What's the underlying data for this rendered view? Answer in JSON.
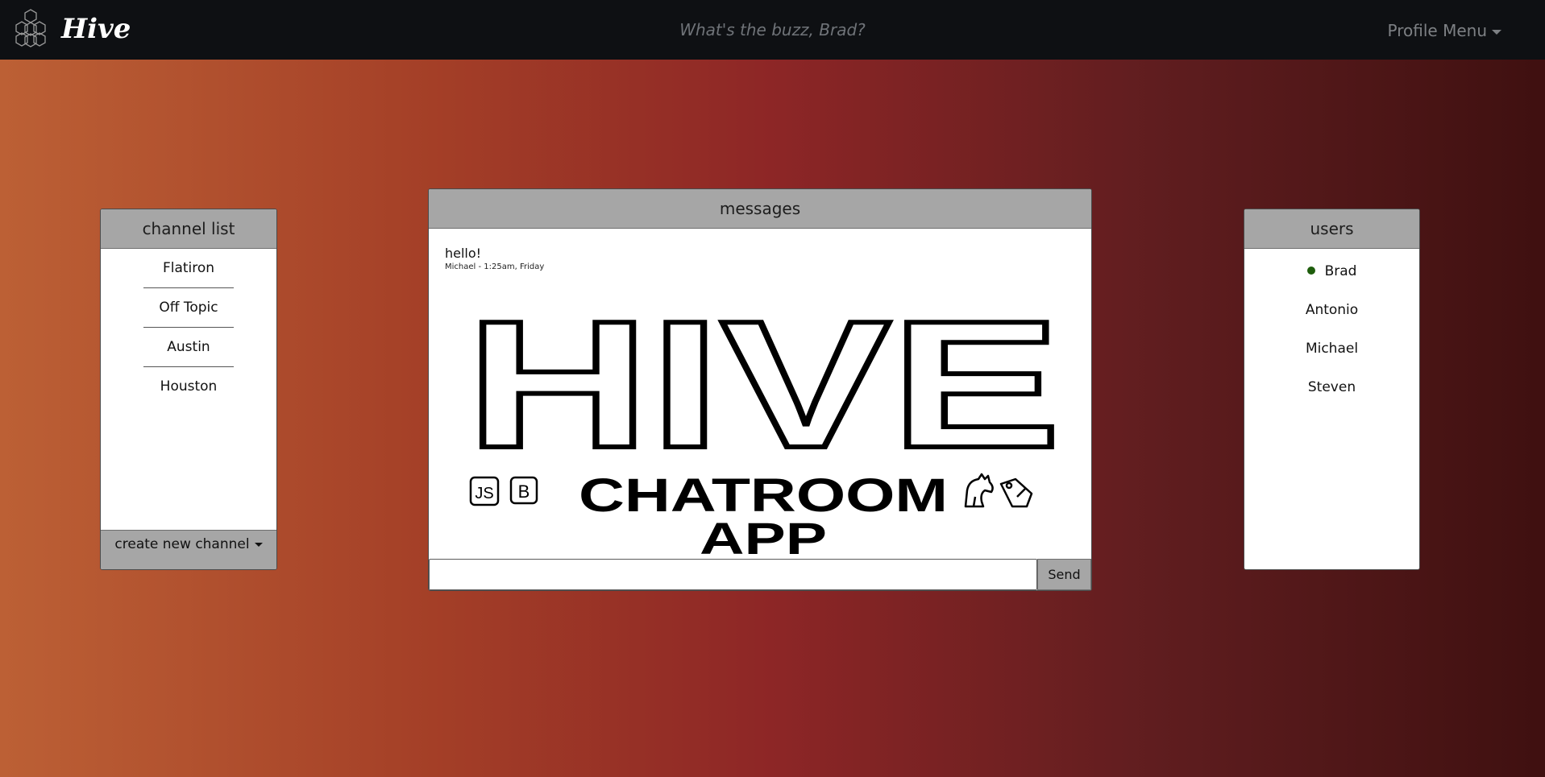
{
  "navbar": {
    "brand_name": "Hive",
    "tagline": "What's the buzz, Brad?",
    "profile_menu_label": "Profile Menu"
  },
  "channels": {
    "title": "channel list",
    "items": [
      "Flatiron",
      "Off Topic",
      "Austin",
      "Houston"
    ],
    "create_label": "create new channel"
  },
  "messages": {
    "title": "messages",
    "list": [
      {
        "text": "hello!",
        "meta": "Michael - 1:25am, Friday"
      }
    ],
    "logo": {
      "title": "HIVE",
      "subtitle_line1": "CHATROOM",
      "subtitle_line2": "APP",
      "badge_js": "JS",
      "badge_b": "B"
    },
    "input_value": "",
    "input_placeholder": "",
    "send_label": "Send"
  },
  "users": {
    "title": "users",
    "list": [
      {
        "name": "Brad",
        "online": true
      },
      {
        "name": "Antonio",
        "online": false
      },
      {
        "name": "Michael",
        "online": false
      },
      {
        "name": "Steven",
        "online": false
      }
    ]
  },
  "colors": {
    "online": "#1e5d0c",
    "panel_header": "#a6a6a6",
    "navbar": "#0e1013"
  }
}
